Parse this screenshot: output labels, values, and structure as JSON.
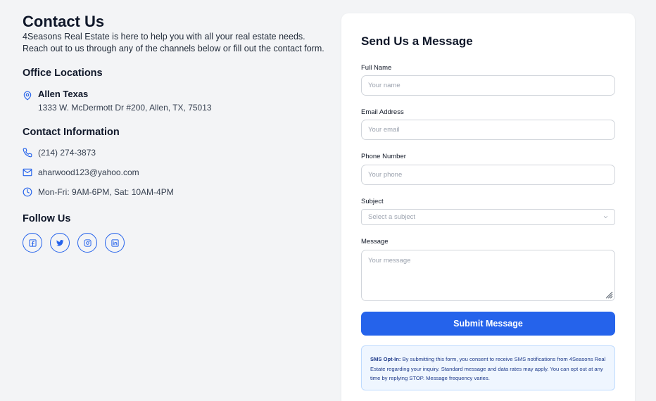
{
  "page": {
    "title": "Contact Us",
    "intro": "4Seasons Real Estate is here to help you with all your real estate needs. Reach out to us through any of the channels below or fill out the contact form."
  },
  "office": {
    "heading": "Office Locations",
    "name": "Allen Texas",
    "address": "1333 W. McDermott Dr #200, Allen, TX, 75013"
  },
  "contact": {
    "heading": "Contact Information",
    "phone": "(214) 274-3873",
    "email": "aharwood123@yahoo.com",
    "hours": "Mon-Fri: 9AM-6PM, Sat: 10AM-4PM"
  },
  "follow": {
    "heading": "Follow Us",
    "icons": [
      "facebook-icon",
      "twitter-icon",
      "instagram-icon",
      "linkedin-icon"
    ]
  },
  "form": {
    "title": "Send Us a Message",
    "name_label": "Full Name",
    "name_placeholder": "Your name",
    "email_label": "Email Address",
    "email_placeholder": "Your email",
    "phone_label": "Phone Number",
    "phone_placeholder": "Your phone",
    "subject_label": "Subject",
    "subject_selected": "Select a subject",
    "message_label": "Message",
    "message_placeholder": "Your message",
    "submit_label": "Submit Message"
  },
  "sms": {
    "title": "SMS Opt-In:",
    "text": " By submitting this form, you consent to receive SMS notifications from 4Seasons Real Estate regarding your inquiry. Standard message and data rates may apply. You can opt out at any time by replying STOP. Message frequency varies."
  },
  "colors": {
    "accent": "#2563eb",
    "background": "#f3f4f6",
    "sms_background": "#eff6ff"
  }
}
